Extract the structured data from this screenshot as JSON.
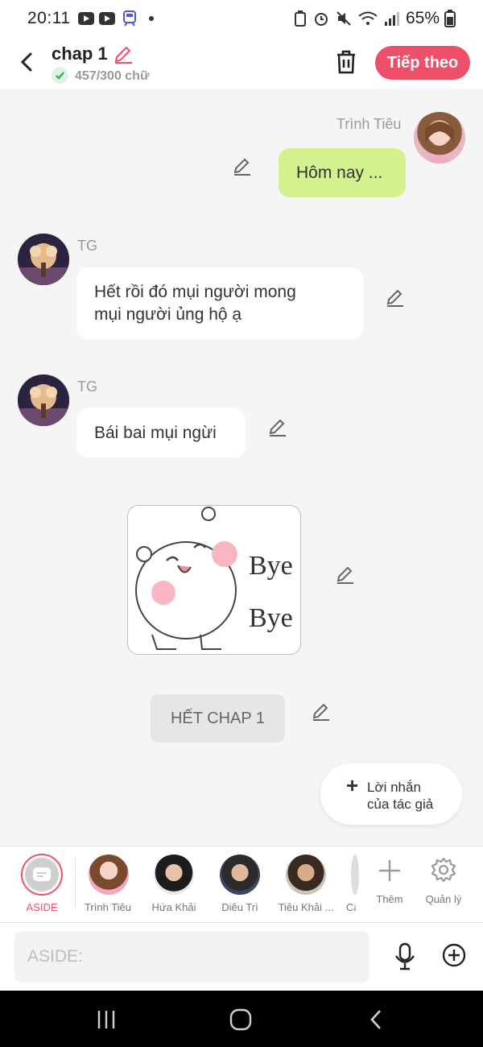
{
  "status_bar": {
    "time": "20:11",
    "battery": "65%"
  },
  "header": {
    "title": "chap 1",
    "counter": "457/300 chữ",
    "next_label": "Tiếp theo"
  },
  "messages": [
    {
      "sender": "Trình Tiêu",
      "text": "Hôm nay ...",
      "side": "right"
    },
    {
      "sender": "TG",
      "lines": [
        "Hết rồi đó mụi người mong",
        "mụi người ủng hộ ạ"
      ],
      "side": "left"
    },
    {
      "sender": "TG",
      "text": "Bái bai mụi ngừi",
      "side": "left"
    }
  ],
  "sticker": {
    "line1": "Bye",
    "line2": "Bye"
  },
  "chapter_end": "HẾT CHAP 1",
  "author_note": {
    "line1": "Lời nhắn",
    "line2": "của tác giả"
  },
  "characters": [
    {
      "label": "ASIDE",
      "active": true
    },
    {
      "label": "Trình Tiêu"
    },
    {
      "label": "Hứa Khải"
    },
    {
      "label": "Diêu Trì"
    },
    {
      "label": "Tiêu Khải ..."
    },
    {
      "label": "Ca"
    }
  ],
  "actions": {
    "add_label": "Thêm",
    "manage_label": "Quản lý"
  },
  "input": {
    "placeholder": "ASIDE:"
  },
  "colors": {
    "accent": "#ee4f6b",
    "green_bubble": "#d3f18e",
    "background": "#f5f5f5"
  }
}
